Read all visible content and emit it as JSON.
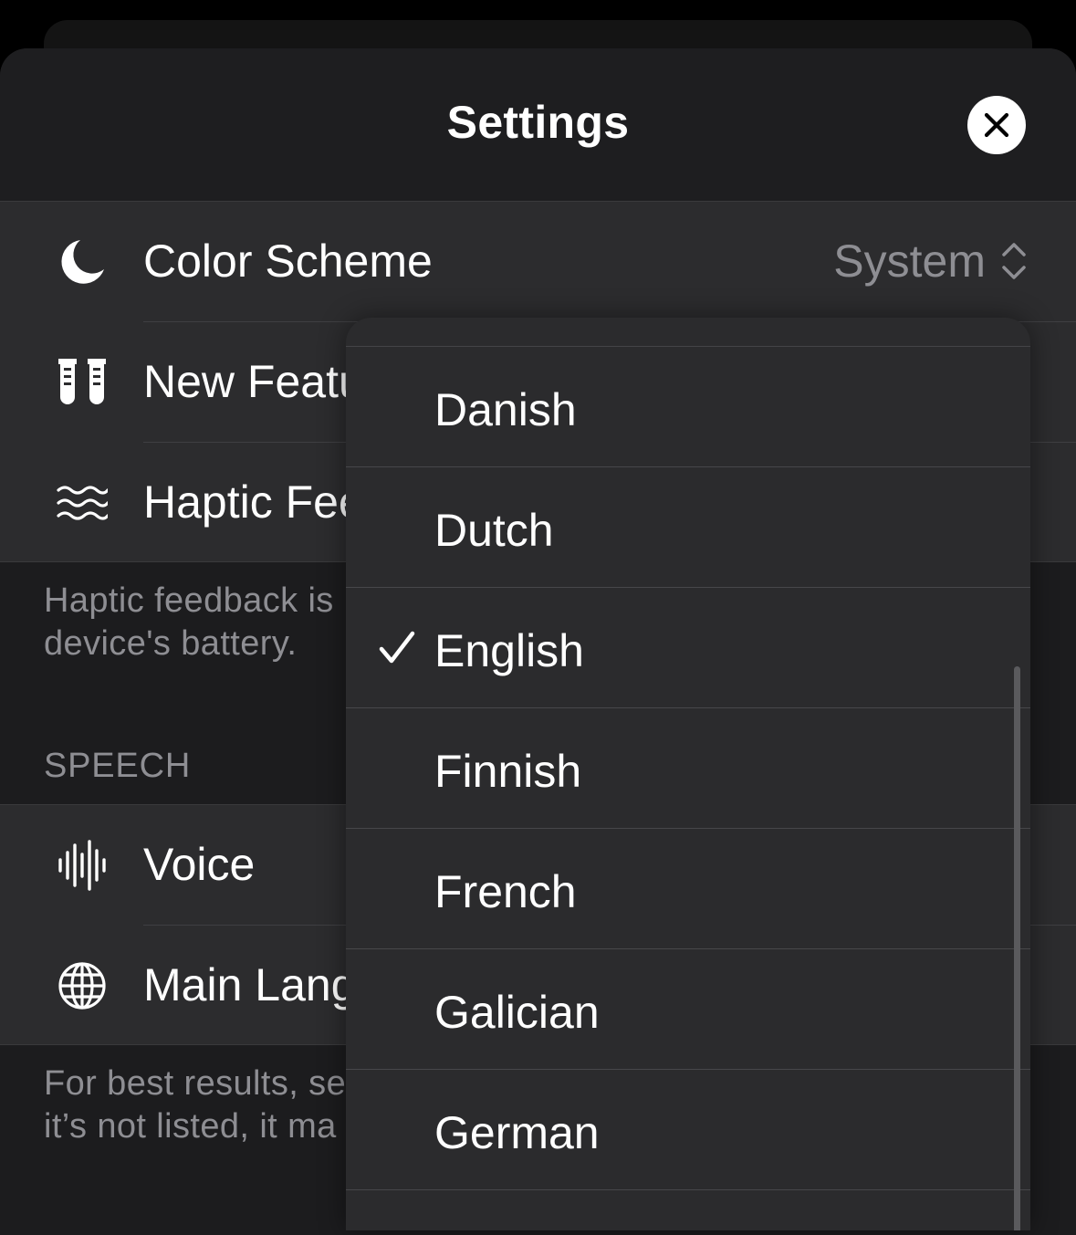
{
  "header": {
    "title": "Settings"
  },
  "general_rows": [
    {
      "icon": "moon-icon",
      "label": "Color Scheme",
      "value": "System"
    },
    {
      "icon": "test-tubes-icon",
      "label": "New Featu"
    },
    {
      "icon": "haptic-waves-icon",
      "label": "Haptic Fee"
    }
  ],
  "haptic_footnote": {
    "line1": "Haptic feedback is",
    "line2": "device's battery."
  },
  "speech": {
    "section_title": "SPEECH",
    "rows": [
      {
        "icon": "waveform-icon",
        "label": "Voice"
      },
      {
        "icon": "globe-icon",
        "label": "Main Lang"
      }
    ],
    "footnote": {
      "line1": "For best results, se",
      "line2": "it’s not listed, it ma"
    }
  },
  "language_menu": {
    "selected": "English",
    "items": [
      "Danish",
      "Dutch",
      "English",
      "Finnish",
      "French",
      "Galician",
      "German"
    ]
  }
}
